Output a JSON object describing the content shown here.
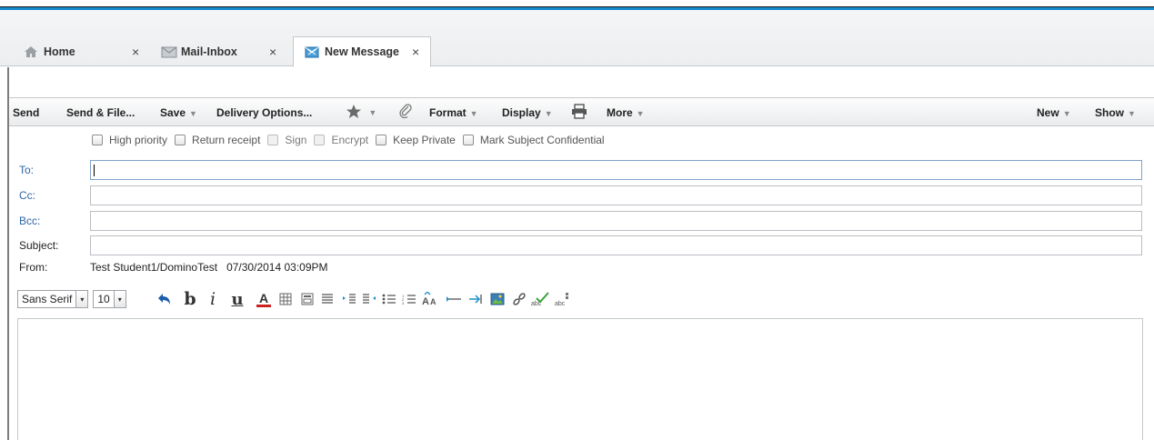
{
  "tabs": [
    {
      "label": "Home",
      "icon": "home-icon"
    },
    {
      "label": "Mail-Inbox",
      "icon": "envelope-icon"
    },
    {
      "label": "New Message",
      "icon": "new-mail-icon"
    }
  ],
  "tab_close_glyph": "×",
  "toolbar": {
    "send": "Send",
    "send_file": "Send & File...",
    "save": "Save",
    "delivery_options": "Delivery Options...",
    "format": "Format",
    "display": "Display",
    "more": "More",
    "new": "New",
    "show": "Show",
    "caret": "▼"
  },
  "options": {
    "high_priority": "High priority",
    "return_receipt": "Return receipt",
    "sign": "Sign",
    "encrypt": "Encrypt",
    "keep_private": "Keep Private",
    "mark_confidential": "Mark Subject Confidential"
  },
  "fields": {
    "to_label": "To:",
    "cc_label": "Cc:",
    "bcc_label": "Bcc:",
    "subject_label": "Subject:",
    "from_label": "From:",
    "from_value": "Test Student1/DominoTest   07/30/2014 03:09PM"
  },
  "format_bar": {
    "font": "Sans Serif",
    "size": "10",
    "dropdown_glyph": "▾"
  },
  "colors": {
    "accent_blue": "#1589c9",
    "label_blue": "#2f64a8"
  }
}
